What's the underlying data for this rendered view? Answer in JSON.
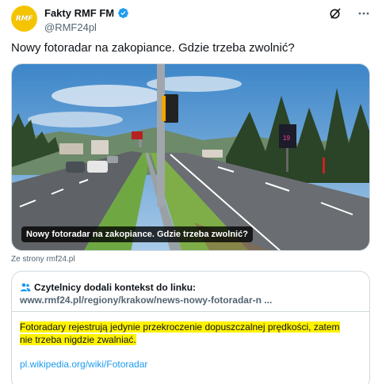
{
  "account": {
    "avatar_text": "RMF",
    "name": "Fakty RMF FM",
    "handle": "@RMF24pl",
    "verified_icon": "verified-badge-icon"
  },
  "toolbar": {
    "icons": [
      "grok-icon",
      "more-icon"
    ]
  },
  "tweet": {
    "text": "Nowy fotoradar na zakopiance. Gdzie trzeba zwolnić?"
  },
  "media": {
    "caption": "Nowy fotoradar na zakopiance. Gdzie trzeba zwolnić?",
    "source": "Ze strony rmf24.pl"
  },
  "note": {
    "heading": "Czytelnicy dodali kontekst do linku:",
    "link": "www.rmf24.pl/regiony/krakow/news-nowy-fotoradar-n ...",
    "body": "Fotoradary rejestrują jedynie przekroczenie dopuszczalnej prędkości, zatem nie trzeba nigdzie zwalniać.",
    "source_link": "pl.wikipedia.org/wiki/Fotoradar"
  },
  "colors": {
    "accent": "#1d9bf0",
    "highlight": "#fff200",
    "avatar_bg": "#f5c400"
  }
}
